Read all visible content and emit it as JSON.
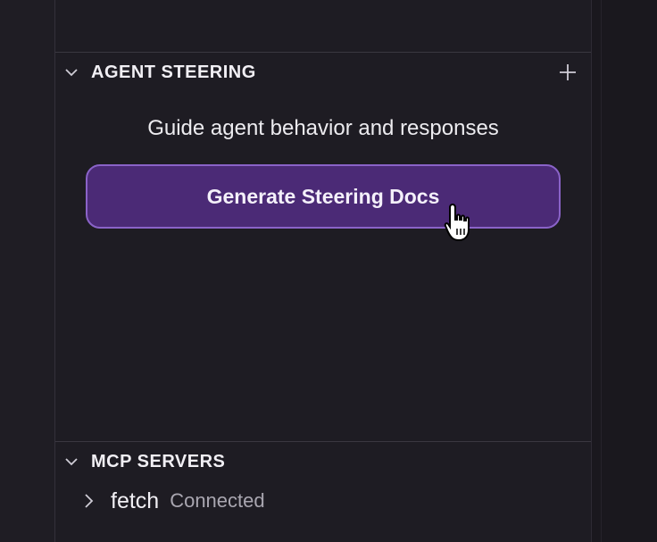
{
  "agent_steering": {
    "title": "AGENT STEERING",
    "description": "Guide agent behavior and responses",
    "button_label": "Generate Steering Docs"
  },
  "mcp_servers": {
    "title": "MCP SERVERS",
    "servers": [
      {
        "name": "fetch",
        "status": "Connected"
      }
    ]
  },
  "colors": {
    "accent": "#4b2a76",
    "accent_border": "#8a63c8",
    "background": "#1e1c23"
  }
}
